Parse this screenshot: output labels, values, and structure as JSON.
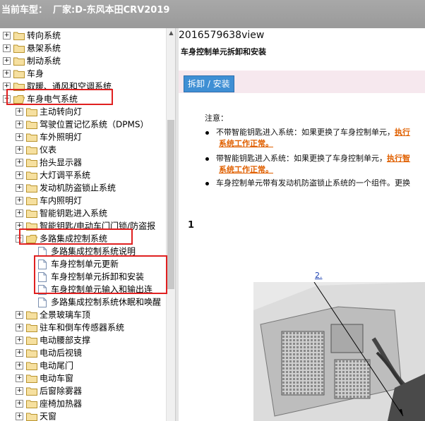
{
  "header": {
    "label": "当前车型：",
    "vehicle": "厂家:D-东风本田CRV2019"
  },
  "tree": {
    "items": [
      {
        "label": "转向系统",
        "type": "folder",
        "level": 0,
        "exp": "+"
      },
      {
        "label": "悬架系统",
        "type": "folder",
        "level": 0,
        "exp": "+"
      },
      {
        "label": "制动系统",
        "type": "folder",
        "level": 0,
        "exp": "+"
      },
      {
        "label": "车身",
        "type": "folder",
        "level": 0,
        "exp": "+"
      },
      {
        "label": "取暖、通风和空调系统",
        "type": "folder",
        "level": 0,
        "exp": "+"
      },
      {
        "label": "车身电气系统",
        "type": "folder-open",
        "level": 0,
        "exp": "-"
      },
      {
        "label": "主动转向灯",
        "type": "folder",
        "level": 1,
        "exp": "+"
      },
      {
        "label": "驾驶位置记忆系统（DPMS）",
        "type": "folder",
        "level": 1,
        "exp": "+"
      },
      {
        "label": "车外照明灯",
        "type": "folder",
        "level": 1,
        "exp": "+"
      },
      {
        "label": "仪表",
        "type": "folder",
        "level": 1,
        "exp": "+"
      },
      {
        "label": "抬头显示器",
        "type": "folder",
        "level": 1,
        "exp": "+"
      },
      {
        "label": "大灯调平系统",
        "type": "folder",
        "level": 1,
        "exp": "+"
      },
      {
        "label": "发动机防盗锁止系统",
        "type": "folder",
        "level": 1,
        "exp": "+"
      },
      {
        "label": "车内照明灯",
        "type": "folder",
        "level": 1,
        "exp": "+"
      },
      {
        "label": "智能钥匙进入系统",
        "type": "folder",
        "level": 1,
        "exp": "+"
      },
      {
        "label": "智能钥匙/电动车门门锁/防盗报",
        "type": "folder",
        "level": 1,
        "exp": "+"
      },
      {
        "label": "多路集成控制系统",
        "type": "folder-open",
        "level": 1,
        "exp": "-"
      },
      {
        "label": "多路集成控制系统说明",
        "type": "doc",
        "level": 2
      },
      {
        "label": "车身控制单元更新",
        "type": "doc",
        "level": 2
      },
      {
        "label": "车身控制单元拆卸和安装",
        "type": "doc",
        "level": 2
      },
      {
        "label": "车身控制单元输入和输出连",
        "type": "doc",
        "level": 2
      },
      {
        "label": "多路集成控制系统休眠和唤醒",
        "type": "doc",
        "level": 2
      },
      {
        "label": "全景玻璃车顶",
        "type": "folder",
        "level": 1,
        "exp": "+"
      },
      {
        "label": "驻车和倒车传感器系统",
        "type": "folder",
        "level": 1,
        "exp": "+"
      },
      {
        "label": "电动腰部支撑",
        "type": "folder",
        "level": 1,
        "exp": "+"
      },
      {
        "label": "电动后视镜",
        "type": "folder",
        "level": 1,
        "exp": "+"
      },
      {
        "label": "电动尾门",
        "type": "folder",
        "level": 1,
        "exp": "+"
      },
      {
        "label": "电动车窗",
        "type": "folder",
        "level": 1,
        "exp": "+"
      },
      {
        "label": "后窗除雾器",
        "type": "folder",
        "level": 1,
        "exp": "+"
      },
      {
        "label": "座椅加热器",
        "type": "folder",
        "level": 1,
        "exp": "+"
      },
      {
        "label": "天窗",
        "type": "folder",
        "level": 1,
        "exp": "+"
      }
    ]
  },
  "content": {
    "doc_id": "2016579638view",
    "subtitle": "车身控制单元拆卸和安装",
    "button": "拆卸 / 安装",
    "note_head": "注意：",
    "notes": [
      {
        "pre": "不带智能钥匙进入系统：如果更换了车身控制单元，",
        "link": "执行"
      },
      {
        "pre": "",
        "link": "系统工作正常。"
      },
      {
        "pre": "带智能钥匙进入系统：如果更换了车身控制单元，",
        "link": "执行智"
      },
      {
        "pre": "",
        "link": "系统工作正常。"
      },
      {
        "pre": "车身控制单元带有发动机防盗锁止系统的一个组件。更换",
        "link": ""
      }
    ],
    "step": "1",
    "callout": "2."
  },
  "colors": {
    "accent_button": "#3f8fd4",
    "highlight_box": "#e02020",
    "link_orange": "#e06000",
    "band": "#f6e8ee"
  }
}
